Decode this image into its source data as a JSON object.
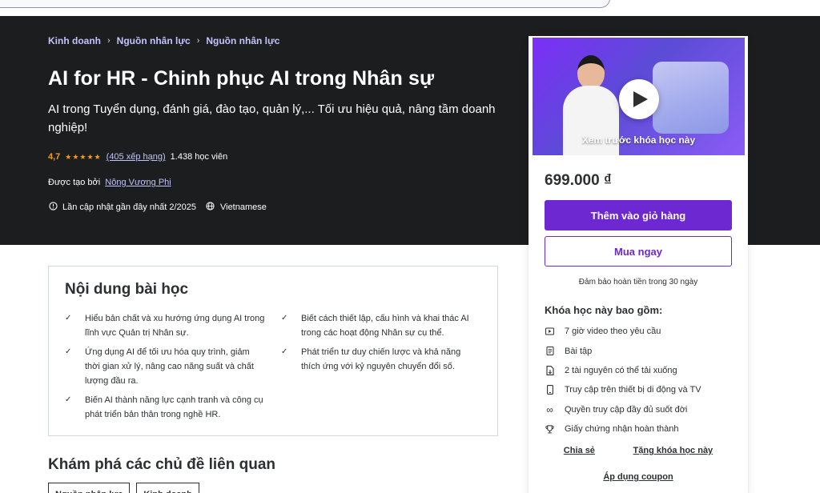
{
  "breadcrumb": [
    "Kinh doanh",
    "Nguồn nhân lực",
    "Nguồn nhân lực"
  ],
  "course": {
    "title": "AI for HR - Chinh phục AI trong Nhân sự",
    "subtitle": "AI trong Tuyển dụng, đánh giá, đào tạo, quản lý,... Tối ưu hiệu quả, nâng tầm doanh nghiệp!",
    "rating": "4,7",
    "rating_fraction": 0.94,
    "rating_count": "(405 xếp hạng)",
    "students": "1.438 học viên",
    "created_by_label": "Được tạo bởi",
    "creator": "Nông Vương Phi",
    "last_updated": "Lần cập nhật gần đây nhất 2/2025",
    "language": "Vietnamese"
  },
  "sidebar": {
    "preview_label": "Xem trước khóa học này",
    "price": "699.000 ₫",
    "add_to_cart": "Thêm vào giỏ hàng",
    "buy_now": "Mua ngay",
    "guarantee": "Đảm bảo hoàn tiền trong 30 ngày",
    "includes_title": "Khóa học này bao gồm:",
    "includes": [
      {
        "icon": "video-icon",
        "label": "7 giờ video theo yêu cầu"
      },
      {
        "icon": "exercise-icon",
        "label": "Bài tập"
      },
      {
        "icon": "download-icon",
        "label": "2 tài nguyên có thể tải xuống"
      },
      {
        "icon": "mobile-icon",
        "label": "Truy cập trên thiết bị di động và TV"
      },
      {
        "icon": "infinity-icon",
        "label": "Quyền truy cập đầy đủ suốt đời"
      },
      {
        "icon": "trophy-icon",
        "label": "Giấy chứng nhận hoàn thành"
      }
    ],
    "share": "Chia sẻ",
    "gift": "Tặng khóa học này",
    "coupon": "Áp dụng coupon"
  },
  "learn": {
    "title": "Nội dung bài học",
    "items_left": [
      "Hiểu bản chất và xu hướng ứng dụng AI trong lĩnh vực Quản trị Nhân sự.",
      "Ứng dụng AI để tối ưu hóa quy trình, giảm thời gian xử lý, nâng cao năng suất và chất lượng đầu ra.",
      "Biến AI thành năng lực cạnh tranh và công cụ phát triển bản thân trong nghề HR."
    ],
    "items_right": [
      "Biết cách thiết lập, cấu hình và khai thác AI trong các hoạt động Nhân sự cụ thể.",
      "Phát triển tư duy chiến lược và khả năng thích ứng với kỷ nguyên chuyển đổi số."
    ]
  },
  "related": {
    "title": "Khám phá các chủ đề liên quan",
    "tags": [
      "Nguồn nhân lực",
      "Kinh doanh"
    ]
  },
  "colors": {
    "hero_bg": "#1c1d1f",
    "accent": "#6d28d2",
    "link": "#c0c4fc",
    "star": "#f69c08"
  }
}
